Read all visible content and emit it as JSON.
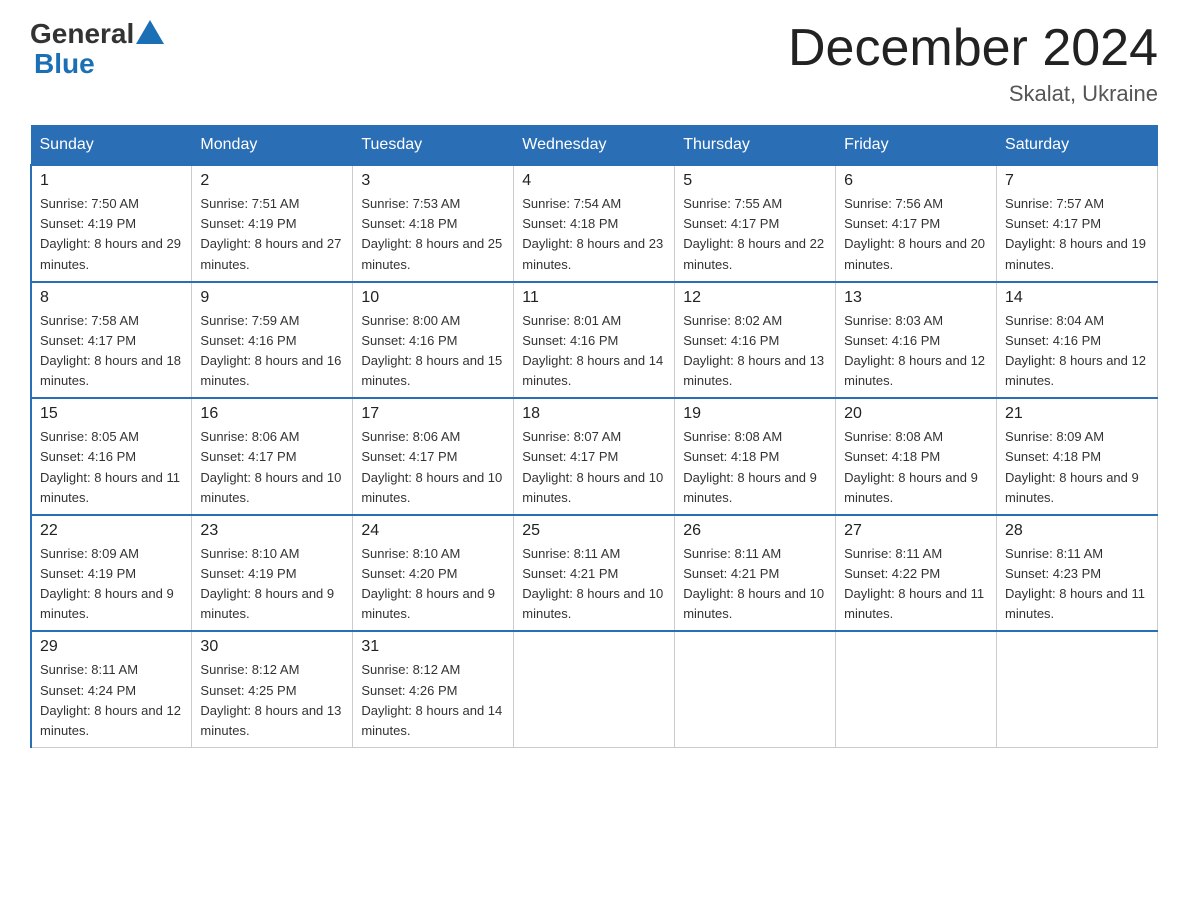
{
  "header": {
    "logo_general": "General",
    "logo_blue": "Blue",
    "title": "December 2024",
    "subtitle": "Skalat, Ukraine"
  },
  "weekdays": [
    "Sunday",
    "Monday",
    "Tuesday",
    "Wednesday",
    "Thursday",
    "Friday",
    "Saturday"
  ],
  "weeks": [
    [
      {
        "day": "1",
        "sunrise": "7:50 AM",
        "sunset": "4:19 PM",
        "daylight": "8 hours and 29 minutes."
      },
      {
        "day": "2",
        "sunrise": "7:51 AM",
        "sunset": "4:19 PM",
        "daylight": "8 hours and 27 minutes."
      },
      {
        "day": "3",
        "sunrise": "7:53 AM",
        "sunset": "4:18 PM",
        "daylight": "8 hours and 25 minutes."
      },
      {
        "day": "4",
        "sunrise": "7:54 AM",
        "sunset": "4:18 PM",
        "daylight": "8 hours and 23 minutes."
      },
      {
        "day": "5",
        "sunrise": "7:55 AM",
        "sunset": "4:17 PM",
        "daylight": "8 hours and 22 minutes."
      },
      {
        "day": "6",
        "sunrise": "7:56 AM",
        "sunset": "4:17 PM",
        "daylight": "8 hours and 20 minutes."
      },
      {
        "day": "7",
        "sunrise": "7:57 AM",
        "sunset": "4:17 PM",
        "daylight": "8 hours and 19 minutes."
      }
    ],
    [
      {
        "day": "8",
        "sunrise": "7:58 AM",
        "sunset": "4:17 PM",
        "daylight": "8 hours and 18 minutes."
      },
      {
        "day": "9",
        "sunrise": "7:59 AM",
        "sunset": "4:16 PM",
        "daylight": "8 hours and 16 minutes."
      },
      {
        "day": "10",
        "sunrise": "8:00 AM",
        "sunset": "4:16 PM",
        "daylight": "8 hours and 15 minutes."
      },
      {
        "day": "11",
        "sunrise": "8:01 AM",
        "sunset": "4:16 PM",
        "daylight": "8 hours and 14 minutes."
      },
      {
        "day": "12",
        "sunrise": "8:02 AM",
        "sunset": "4:16 PM",
        "daylight": "8 hours and 13 minutes."
      },
      {
        "day": "13",
        "sunrise": "8:03 AM",
        "sunset": "4:16 PM",
        "daylight": "8 hours and 12 minutes."
      },
      {
        "day": "14",
        "sunrise": "8:04 AM",
        "sunset": "4:16 PM",
        "daylight": "8 hours and 12 minutes."
      }
    ],
    [
      {
        "day": "15",
        "sunrise": "8:05 AM",
        "sunset": "4:16 PM",
        "daylight": "8 hours and 11 minutes."
      },
      {
        "day": "16",
        "sunrise": "8:06 AM",
        "sunset": "4:17 PM",
        "daylight": "8 hours and 10 minutes."
      },
      {
        "day": "17",
        "sunrise": "8:06 AM",
        "sunset": "4:17 PM",
        "daylight": "8 hours and 10 minutes."
      },
      {
        "day": "18",
        "sunrise": "8:07 AM",
        "sunset": "4:17 PM",
        "daylight": "8 hours and 10 minutes."
      },
      {
        "day": "19",
        "sunrise": "8:08 AM",
        "sunset": "4:18 PM",
        "daylight": "8 hours and 9 minutes."
      },
      {
        "day": "20",
        "sunrise": "8:08 AM",
        "sunset": "4:18 PM",
        "daylight": "8 hours and 9 minutes."
      },
      {
        "day": "21",
        "sunrise": "8:09 AM",
        "sunset": "4:18 PM",
        "daylight": "8 hours and 9 minutes."
      }
    ],
    [
      {
        "day": "22",
        "sunrise": "8:09 AM",
        "sunset": "4:19 PM",
        "daylight": "8 hours and 9 minutes."
      },
      {
        "day": "23",
        "sunrise": "8:10 AM",
        "sunset": "4:19 PM",
        "daylight": "8 hours and 9 minutes."
      },
      {
        "day": "24",
        "sunrise": "8:10 AM",
        "sunset": "4:20 PM",
        "daylight": "8 hours and 9 minutes."
      },
      {
        "day": "25",
        "sunrise": "8:11 AM",
        "sunset": "4:21 PM",
        "daylight": "8 hours and 10 minutes."
      },
      {
        "day": "26",
        "sunrise": "8:11 AM",
        "sunset": "4:21 PM",
        "daylight": "8 hours and 10 minutes."
      },
      {
        "day": "27",
        "sunrise": "8:11 AM",
        "sunset": "4:22 PM",
        "daylight": "8 hours and 11 minutes."
      },
      {
        "day": "28",
        "sunrise": "8:11 AM",
        "sunset": "4:23 PM",
        "daylight": "8 hours and 11 minutes."
      }
    ],
    [
      {
        "day": "29",
        "sunrise": "8:11 AM",
        "sunset": "4:24 PM",
        "daylight": "8 hours and 12 minutes."
      },
      {
        "day": "30",
        "sunrise": "8:12 AM",
        "sunset": "4:25 PM",
        "daylight": "8 hours and 13 minutes."
      },
      {
        "day": "31",
        "sunrise": "8:12 AM",
        "sunset": "4:26 PM",
        "daylight": "8 hours and 14 minutes."
      },
      null,
      null,
      null,
      null
    ]
  ]
}
